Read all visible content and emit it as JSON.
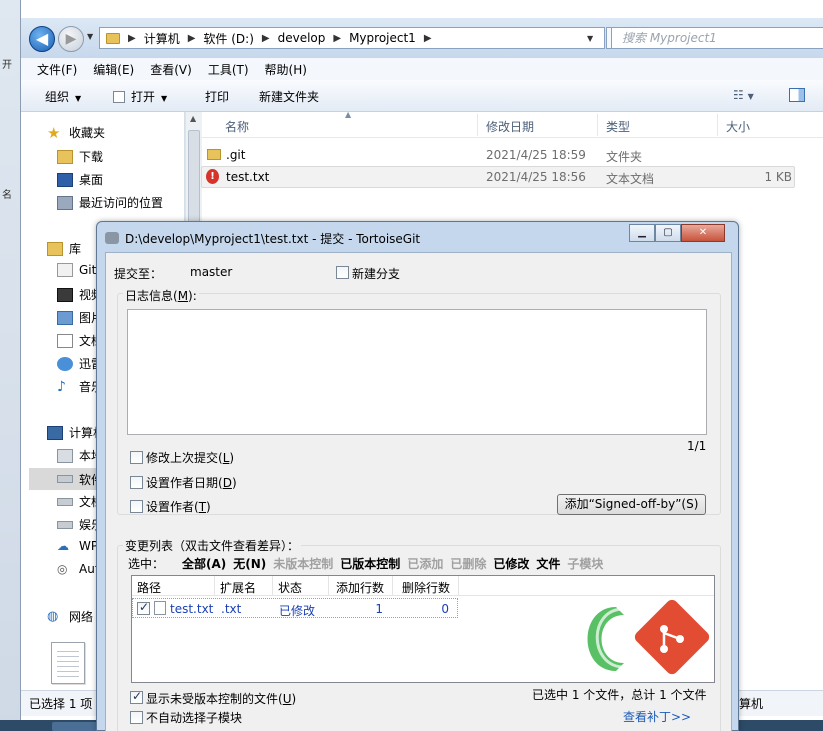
{
  "left_fragments": [
    "开",
    "名"
  ],
  "explorer": {
    "path": [
      "计算机",
      "软件 (D:)",
      "develop",
      "Myproject1"
    ],
    "search_placeholder": "搜索 Myproject1",
    "menu": [
      "文件(F)",
      "编辑(E)",
      "查看(V)",
      "工具(T)",
      "帮助(H)"
    ],
    "toolbar": {
      "organize": "组织",
      "open": "打开",
      "print": "打印",
      "new_folder": "新建文件夹"
    },
    "nav": {
      "favorites": "收藏夹",
      "downloads": "下载",
      "desktop": "桌面",
      "recent": "最近访问的位置",
      "libraries": "库",
      "lib_git": "Git",
      "lib_video": "视频",
      "lib_pictures": "图片",
      "lib_docs": "文档",
      "lib_xunlei": "迅雷",
      "lib_music": "音乐",
      "computer": "计算机",
      "drive_local": "本地",
      "drive_software": "软件",
      "drive_docs": "文档",
      "drive_ent": "娱乐",
      "wps": "WPS",
      "auto": "Auto",
      "network": "网络"
    },
    "columns": {
      "name": "名称",
      "modified": "修改日期",
      "type": "类型",
      "size": "大小"
    },
    "files": [
      {
        "name": ".git",
        "modified": "2021/4/25 18:59",
        "type": "文件夹",
        "size": ""
      },
      {
        "name": "test.txt",
        "modified": "2021/4/25 18:56",
        "type": "文本文档",
        "size": "1 KB"
      }
    ],
    "status_left": "已选择 1 项",
    "status_right": "算机"
  },
  "dialog": {
    "title": "D:\\develop\\Myproject1\\test.txt - 提交 - TortoiseGit",
    "commit_to_label": "提交至：",
    "branch": "master",
    "new_branch": "新建分支",
    "log_label": "日志信息(",
    "log_key": "M",
    "log_label_end": "):",
    "counter": "1/1",
    "amend": {
      "text": "修改上次提交(",
      "key": "L",
      "end": ")"
    },
    "author_date": {
      "text": "设置作者日期(",
      "key": "D",
      "end": ")"
    },
    "author": {
      "text": "设置作者(",
      "key": "T",
      "end": ")"
    },
    "signed_off": "添加“Signed-off-by”(S)",
    "changes_label": "变更列表（双击文件查看差异）：",
    "select_label": "选中：",
    "filters": [
      {
        "label": "全部(A)",
        "on": true
      },
      {
        "label": "无(N)",
        "on": true
      },
      {
        "label": "未版本控制",
        "on": false
      },
      {
        "label": "已版本控制",
        "on": true
      },
      {
        "label": "已添加",
        "on": false
      },
      {
        "label": "已删除",
        "on": false
      },
      {
        "label": "已修改",
        "on": true
      },
      {
        "label": "文件",
        "on": true
      },
      {
        "label": "子模块",
        "on": false
      }
    ],
    "table_headers": [
      "路径",
      "扩展名",
      "状态",
      "添加行数",
      "删除行数"
    ],
    "row": {
      "path": "test.txt",
      "ext": ".txt",
      "status": "已修改",
      "added": "1",
      "deleted": "0"
    },
    "show_unversioned": {
      "text": "显示未受版本控制的文件(",
      "key": "U",
      "end": ")"
    },
    "no_auto_submodule": "不自动选择子模块",
    "summary": "已选中 1 个文件，总计 1 个文件",
    "view_patch": "查看补丁>>"
  },
  "colors": {
    "title_bg": "#c4d7ed",
    "link": "#1d5bb8",
    "logo_green": "#3cb54a",
    "git_red": "#e24c32"
  }
}
